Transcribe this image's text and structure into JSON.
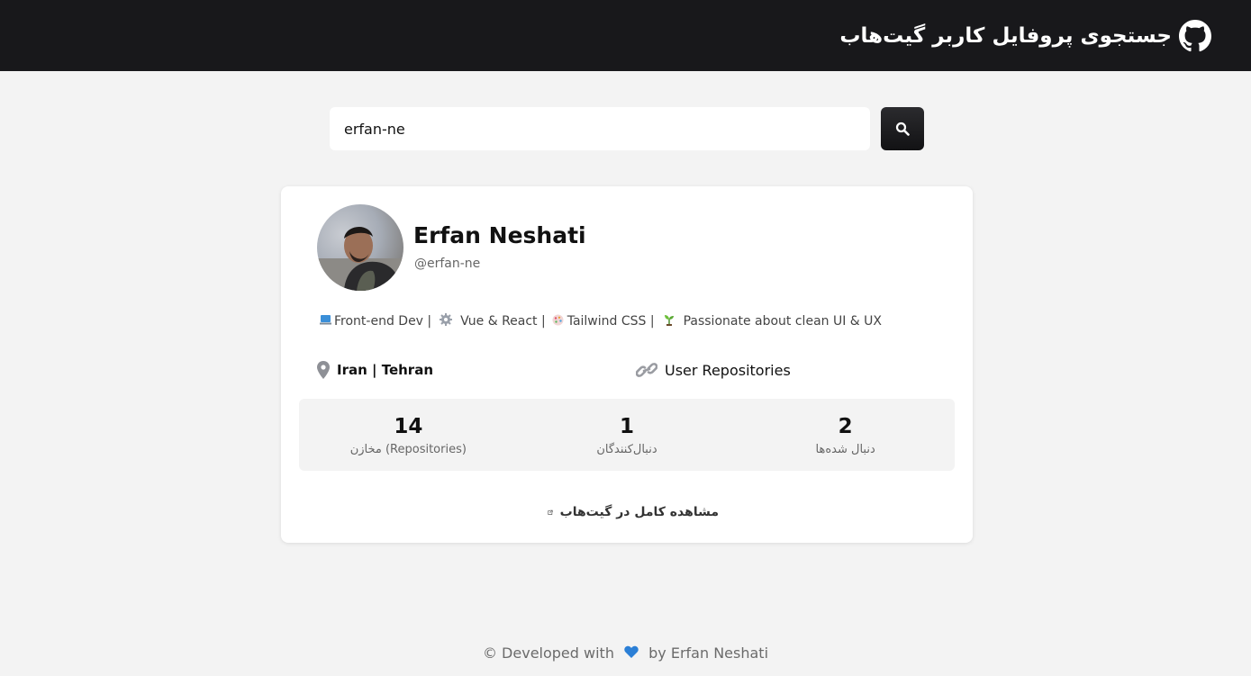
{
  "header": {
    "title": "جستجوی پروفایل کاربر گیت‌هاب",
    "icon": "github-icon",
    "background": "#18181b"
  },
  "search": {
    "value": "erfan-ne",
    "button_icon": "search-icon"
  },
  "profile": {
    "name": "Erfan Neshati",
    "login": "@erfan-ne",
    "bio": {
      "part1": "Front-end Dev |",
      "part2": "Vue & React |",
      "part3": "Tailwind CSS |",
      "part4": "Passionate about clean UI & UX"
    },
    "location": "Iran | Tehran",
    "repos_link": "User Repositories"
  },
  "stats": [
    {
      "value": "14",
      "label": "مخازن (Repositories)"
    },
    {
      "value": "1",
      "label": "دنبال‌کنندگان"
    },
    {
      "value": "2",
      "label": "دنبال شده‌ها"
    }
  ],
  "full_link": "مشاهده کامل در گیت‌هاب",
  "footer": {
    "before": "© Developed with",
    "after": "by Erfan Neshati",
    "heart_color": "#2b7fd6"
  }
}
